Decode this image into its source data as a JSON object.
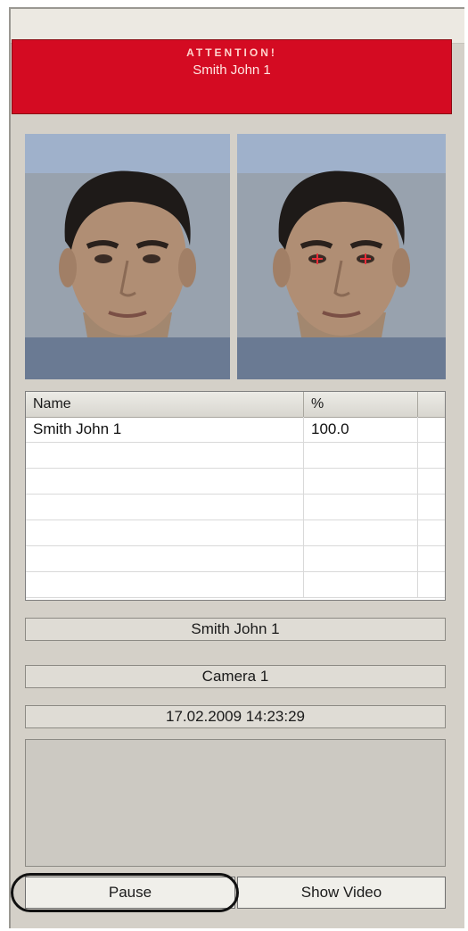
{
  "alert": {
    "title": "ATTENTION!",
    "name": "Smith John 1",
    "color": "#d40b22"
  },
  "photos": {
    "left": "face-photo",
    "right": "face-photo-with-eye-markers",
    "marker_color": "#e8303a"
  },
  "grid": {
    "columns": [
      "Name",
      "%"
    ],
    "rows": [
      {
        "name": "Smith John 1",
        "percent": "100.0"
      },
      {
        "name": "",
        "percent": ""
      },
      {
        "name": "",
        "percent": ""
      },
      {
        "name": "",
        "percent": ""
      },
      {
        "name": "",
        "percent": ""
      },
      {
        "name": "",
        "percent": ""
      },
      {
        "name": "",
        "percent": ""
      }
    ]
  },
  "info": {
    "person": "Smith John 1",
    "camera": "Camera 1",
    "timestamp": "17.02.2009 14:23:29"
  },
  "buttons": {
    "pause": "Pause",
    "show_video": "Show Video"
  }
}
